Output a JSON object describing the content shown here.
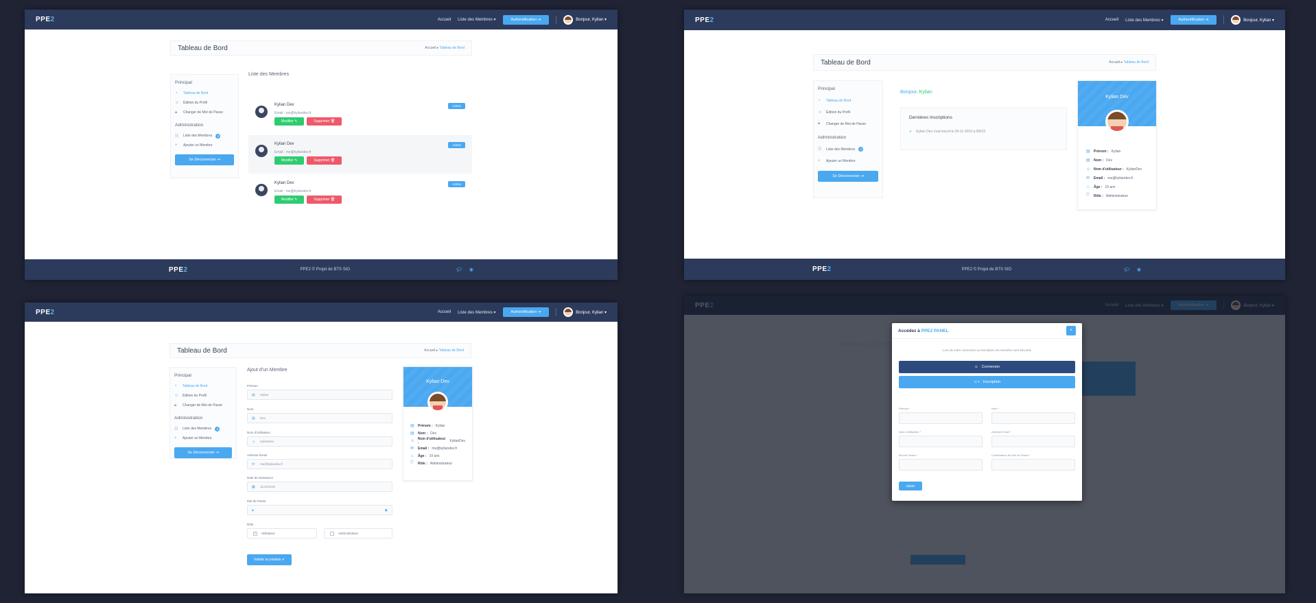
{
  "nav": {
    "logo_text": "PPE",
    "logo_num": "2",
    "home": "Accueil",
    "members": "Liste des Membres ▾",
    "auth_button": "Authentification ⇥",
    "user_greeting": "Bonjour, Kylian ▾"
  },
  "footer": {
    "logo_text": "PPE",
    "logo_num": "2",
    "copyright": "PPE2 © Projet de BTS SIO"
  },
  "header": {
    "title": "Tableau de Bord",
    "crumb_home": "Accueil",
    "crumb_sep": "▸",
    "crumb_current": "Tableau de Bord"
  },
  "sidebar": {
    "principal_title": "Principal",
    "admin_title": "Administration",
    "dashboard": "Tableau de Bord",
    "edit_profile": "Édition du Profil",
    "change_password": "Changer de Mot de Passe",
    "members_list": "Liste des Membres",
    "members_count": "3",
    "add_member": "Ajouter un Membre",
    "logout": "Se Déconnecter ⇥"
  },
  "members_page": {
    "title": "Liste des Membres",
    "members": [
      {
        "name": "Kylian Dev",
        "email": "Email : me@kyliandev.fr",
        "role": "Admin",
        "edit": "Modifier ✎",
        "delete": "Supprimer 🗑"
      },
      {
        "name": "Kylian Dev",
        "email": "Email : me@kyliandev.fr",
        "role": "Admin",
        "edit": "Modifier ✎",
        "delete": "Supprimer 🗑"
      },
      {
        "name": "Kylian Dev",
        "email": "Email : me@kyliandev.fr",
        "role": "Admin",
        "edit": "Modifier ✎",
        "delete": "Supprimer 🗑"
      }
    ]
  },
  "dashboard": {
    "hello": "Bonjour,",
    "hello_name": "Kylian",
    "inscriptions_title": "Dernières Inscriptions",
    "inscription_line": "Kylian Dev s'est inscrit le 03-11-2019 à 09h22"
  },
  "profile": {
    "name": "Kylian Dev",
    "prenom_label": "Prénom :",
    "prenom": "Kylian",
    "nom_label": "Nom :",
    "nom": "Dev",
    "username_label": "Nom d'utilisateur :",
    "username": "KylianDev",
    "email_label": "Email :",
    "email": "me@kyliandev.fr",
    "age_label": "Âge :",
    "age": "19 ans",
    "role_label": "Rôle :",
    "role": "Administrateur"
  },
  "add_member": {
    "title": "Ajout d'un Membre",
    "prenom_label": "Prénom",
    "prenom_value": "Kylian",
    "nom_label": "Nom",
    "nom_value": "Dev",
    "username_label": "Nom d'Utilisateur",
    "username_value": "KylianDev",
    "email_label": "Adresse Email",
    "email_value": "me@kyliandev.fr",
    "birth_label": "Date de Naissance",
    "birth_value": "11/11/2019",
    "password_label": "Mot de Passe",
    "role_label": "Rôle",
    "role_user": "Utilisateur",
    "role_admin": "Administrateur",
    "submit": "Valider la création ✔"
  },
  "modal": {
    "title_prefix": "Accédez à",
    "title_brand": "PPE2 PANEL",
    "close": "×",
    "description": "Lors de votre connexion ou inscription les données sont sécurisé",
    "connexion": "Connexion",
    "inscription": "Inscription",
    "prenom": "Prénom *",
    "nom": "Nom *",
    "username": "Nom d'utilisateur *",
    "email": "Adresse Email *",
    "password": "Mot de Passe *",
    "confirm": "Confirmation du Mot de Passe *",
    "submit": "Valider"
  }
}
